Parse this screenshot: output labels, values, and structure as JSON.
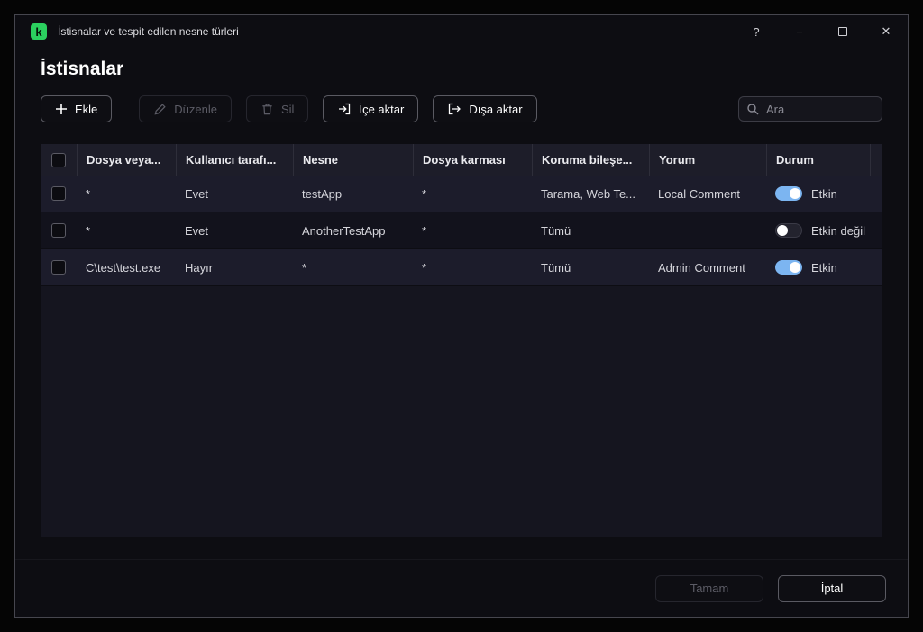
{
  "window": {
    "title": "İstisnalar ve tespit edilen nesne türleri",
    "controls": {
      "help": "?",
      "minimize": "−",
      "close": "✕"
    }
  },
  "page": {
    "title": "İstisnalar"
  },
  "toolbar": {
    "add_label": "Ekle",
    "edit_label": "Düzenle",
    "delete_label": "Sil",
    "import_label": "İçe aktar",
    "export_label": "Dışa aktar",
    "search_placeholder": "Ara"
  },
  "table": {
    "columns": [
      "Dosya veya...",
      "Kullanıcı tarafı...",
      "Nesne",
      "Dosya karması",
      "Koruma bileşe...",
      "Yorum",
      "Durum"
    ],
    "rows": [
      {
        "file": "*",
        "user": "Evet",
        "object": "testApp",
        "hash": "*",
        "component": "Tarama, Web Te...",
        "comment": "Local Comment",
        "status": "Etkin",
        "enabled": true
      },
      {
        "file": "*",
        "user": "Evet",
        "object": "AnotherTestApp",
        "hash": "*",
        "component": "Tümü",
        "comment": "",
        "status": "Etkin değil",
        "enabled": false
      },
      {
        "file": "C\\test\\test.exe",
        "user": "Hayır",
        "object": "*",
        "hash": "*",
        "component": "Tümü",
        "comment": "Admin Comment",
        "status": "Etkin",
        "enabled": true
      }
    ]
  },
  "footer": {
    "ok_label": "Tamam",
    "cancel_label": "İptal"
  },
  "colors": {
    "toggle_on": "#7cb5f1",
    "brand_green": "#2bd05f"
  }
}
